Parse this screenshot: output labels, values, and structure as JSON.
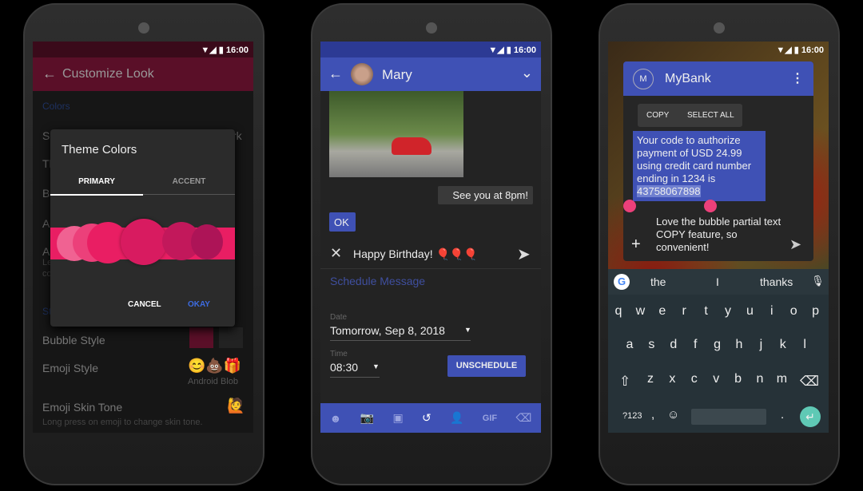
{
  "status": {
    "time": "16:00"
  },
  "phone1": {
    "title": "Customize Look",
    "section_colors": "Colors",
    "partial_rows": [
      "So",
      "Th",
      "Bu",
      "Au",
      "Ad",
      "Le",
      "co",
      "St"
    ],
    "partial_right": "rk",
    "dialog": {
      "title": "Theme Colors",
      "tabs": [
        "PRIMARY",
        "ACCENT"
      ],
      "active_tab": "PRIMARY",
      "cancel": "CANCEL",
      "okay": "OKAY",
      "swatches": [
        "#f06292",
        "#ec407a",
        "#e91e63",
        "#d81b60",
        "#c2185b",
        "#ad1457",
        "#e91e63"
      ]
    },
    "bubble_style": "Bubble Style",
    "emoji_style": "Emoji Style",
    "emoji_style_value": "Android Blob",
    "emoji_skin_tone": "Emoji Skin Tone",
    "emoji_skin_hint": "Long press on emoji to change skin tone.",
    "primary_color": "#5a0f28"
  },
  "phone2": {
    "contact": "Mary",
    "sent_message": "See you at 8pm!",
    "received_message": "OK",
    "compose_text": "Happy Birthday! 🎈🎈🎈",
    "schedule_title": "Schedule Message",
    "date_label": "Date",
    "date_value": "Tomorrow, Sep 8, 2018",
    "time_label": "Time",
    "time_value": "08:30",
    "unschedule": "UNSCHEDULE",
    "toolbar_icons": [
      "emoji-icon",
      "camera-icon",
      "gallery-icon",
      "schedule-icon",
      "contact-icon",
      "gif-icon",
      "delete-icon"
    ],
    "gif": "GIF",
    "primary_color": "#3f51b5"
  },
  "phone3": {
    "avatar_letter": "M",
    "sender": "MyBank",
    "copy": "COPY",
    "select_all": "SELECT ALL",
    "message_lines": [
      "Your code to authorize",
      "payment of USD 24.99",
      "using credit card number",
      "ending in 1234 is"
    ],
    "selected_code": "43758067898",
    "reply_text": "Love the bubble partial text COPY feature, so convenient!",
    "suggestions": [
      "the",
      "I",
      "thanks"
    ],
    "rows": [
      [
        "q",
        "w",
        "e",
        "r",
        "t",
        "y",
        "u",
        "i",
        "o",
        "p"
      ],
      [
        "a",
        "s",
        "d",
        "f",
        "g",
        "h",
        "j",
        "k",
        "l"
      ],
      [
        "z",
        "x",
        "c",
        "v",
        "b",
        "n",
        "m"
      ]
    ],
    "numbers_key": "?123",
    "comma": ",",
    "period": "."
  }
}
